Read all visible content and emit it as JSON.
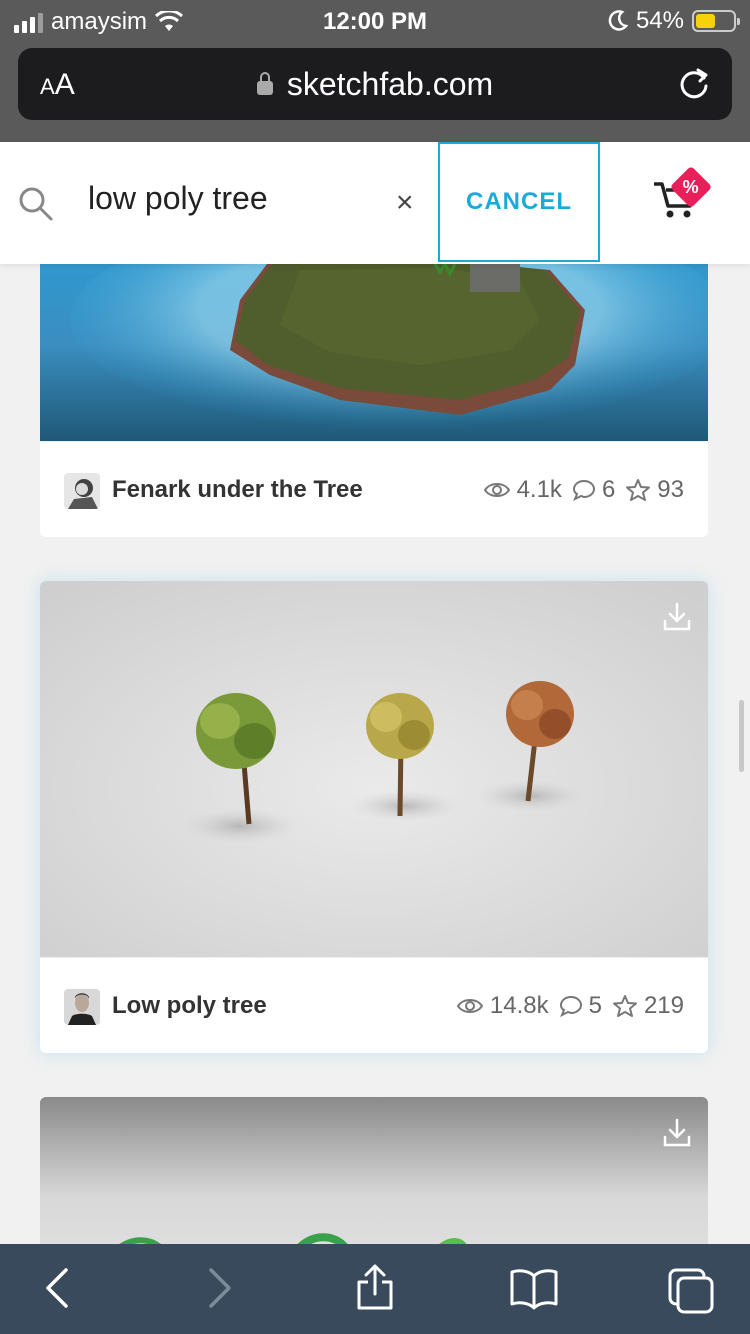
{
  "status_bar": {
    "carrier": "amaysim",
    "time": "12:00 PM",
    "battery_percent": "54%",
    "icons": [
      "signal-icon",
      "wifi-icon",
      "moon-icon",
      "battery-icon"
    ]
  },
  "browser": {
    "text_size_label_small": "A",
    "text_size_label_large": "A",
    "url": "sketchfab.com"
  },
  "search": {
    "query": "low poly tree",
    "clear_label": "×",
    "cancel_label": "CANCEL",
    "cart_badge": "%"
  },
  "results": [
    {
      "title": "Fenark under the Tree",
      "views": "4.1k",
      "comments": "6",
      "likes": "93"
    },
    {
      "title": "Low poly tree",
      "views": "14.8k",
      "comments": "5",
      "likes": "219"
    }
  ],
  "colors": {
    "accent": "#1caad9",
    "badge": "#e8205a",
    "toolbar": "#394a5c"
  },
  "toolbar_icons": [
    "back-icon",
    "forward-icon",
    "share-icon",
    "bookmarks-icon",
    "tabs-icon"
  ]
}
